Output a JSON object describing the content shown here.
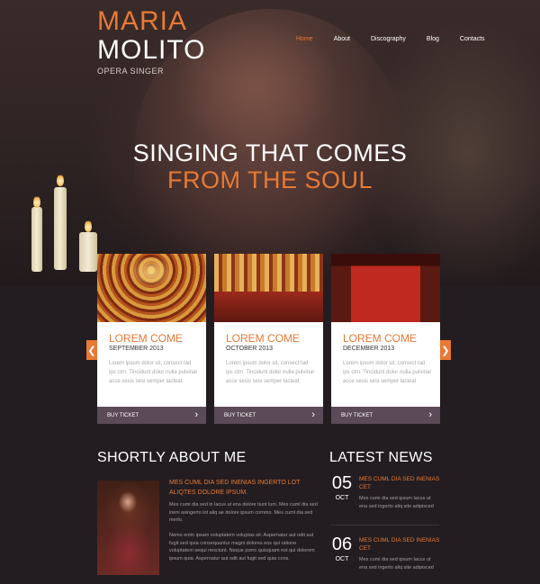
{
  "logo": {
    "first": "MARIA",
    "last": "MOLITO",
    "sub": "OPERA SINGER"
  },
  "nav": {
    "items": [
      "Home",
      "About",
      "Discography",
      "Blog",
      "Contacts"
    ],
    "active": "Home"
  },
  "hero": {
    "line1": "SINGING THAT COMES",
    "line2": "FROM THE SOUL"
  },
  "cards": [
    {
      "title": "LOREM COME",
      "date": "SEPTEMBER 2013",
      "text": "Lorem ipsum dolor sit, consect tad ips ctm. Tincidunt dolor nulla pulvinar acce sesis sesi semper lacteat",
      "button": "BUY TICKET"
    },
    {
      "title": "LOREM COME",
      "date": "OCTOBER 2013",
      "text": "Lorem ipsum dolor sit, consect tad ips ctm. Tincidunt dolor nulla pulvinar acce sesis sesi semper lacteat",
      "button": "BUY TICKET"
    },
    {
      "title": "LOREM COME",
      "date": "DECEMBER 2013",
      "text": "Lorem ipsum dolor sit, consect tad ips ctm. Tincidunt dolor nulla pulvinar acce sesis sesi semper lacteat",
      "button": "BUY TICKET"
    }
  ],
  "slider": {
    "prev_icon": "chevron-left-icon",
    "next_icon": "chevron-right-icon"
  },
  "about": {
    "title": "SHORTLY ABOUT ME",
    "heading": "MES CUML DIA SED INENIAS INGERTO LOT ALIQTES DOLORE IPSUM.",
    "p1": "Mes cumi dia sed in lacus ut ena dolore tiunt lum. Mes cuml dia sed ineni asingerto lot aliq ae dolore ipsum commo. Mes cuml dia sed merlo.",
    "p2": "Nemo enim ipsam voluptatem voluptas sit. Aspernatur aut odit aut fugit sed quia consequuntur magni dolores eos qui ratione voluptatem sequi nesciunt. Neque porro quisquam est qui dolorem ipsum quia. Aspernatur aut odit aut fugit sed quia cons."
  },
  "news": {
    "title": "LATEST NEWS",
    "items": [
      {
        "day": "05",
        "month": "OCT",
        "title": "MES CUML DIA SED INENIAS CET",
        "text": "Mes cumi dia sed ipsum lacus ut ena sed ingerto aliq site adipisced"
      },
      {
        "day": "06",
        "month": "OCT",
        "title": "MES CUML DIA SED INENIAS CET",
        "text": "Mes cumi dia sed ipsum lacus ut ena sed ingerto aliq site adipisced"
      }
    ]
  },
  "colors": {
    "accent": "#e87a35",
    "background": "#231d21",
    "button": "#5b4a58"
  }
}
